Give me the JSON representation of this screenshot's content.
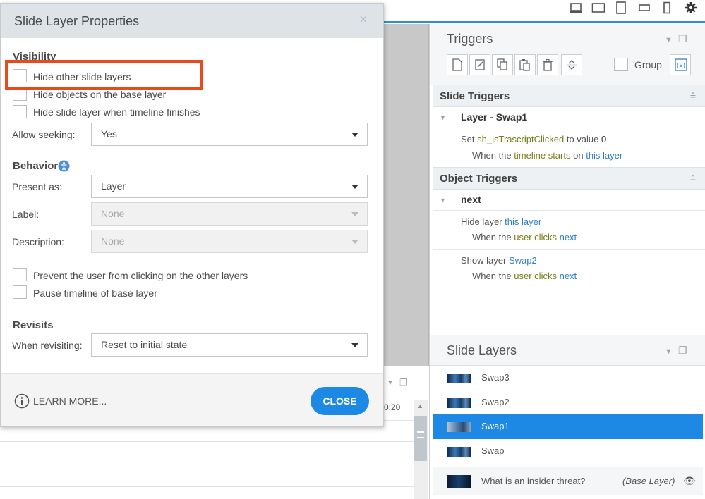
{
  "dialog": {
    "title": "Slide Layer Properties",
    "close_x": "×",
    "visibility": {
      "heading": "Visibility",
      "hide_other": "Hide other slide layers",
      "hide_base": "Hide objects on the base layer",
      "hide_when_finish": "Hide slide layer when timeline finishes",
      "allow_seeking_label": "Allow seeking:",
      "allow_seeking_value": "Yes"
    },
    "behavior": {
      "heading": "Behavior",
      "present_as_label": "Present as:",
      "present_as_value": "Layer",
      "label_label": "Label:",
      "label_value": "None",
      "description_label": "Description:",
      "description_value": "None",
      "prevent_click": "Prevent the user from clicking on the other layers",
      "pause_timeline": "Pause timeline of base layer"
    },
    "revisits": {
      "heading": "Revisits",
      "when_label": "When revisiting:",
      "when_value": "Reset to initial state"
    },
    "footer": {
      "learn_more": "LEARN MORE...",
      "close": "CLOSE"
    }
  },
  "timeline": {
    "time_label": "0:20"
  },
  "triggers_panel": {
    "title": "Triggers",
    "group_label": "Group",
    "slide_triggers": {
      "heading": "Slide Triggers",
      "group_name": "Layer - Swap1",
      "items": [
        {
          "action": "Set",
          "target": "sh_isTrascriptClicked",
          "mid": "to value",
          "value": "0",
          "when": "When the",
          "event": "timeline starts",
          "on": "on",
          "object": "this layer"
        }
      ]
    },
    "object_triggers": {
      "heading": "Object Triggers",
      "group_name": "next",
      "items": [
        {
          "action": "Hide layer",
          "target": "this layer",
          "when": "When the",
          "event": "user clicks",
          "object": "next"
        },
        {
          "action": "Show layer",
          "target": "Swap2",
          "when": "When the",
          "event": "user clicks",
          "object": "next"
        }
      ]
    }
  },
  "layers_panel": {
    "title": "Slide Layers",
    "layers": [
      {
        "name": "Swap3",
        "selected": false
      },
      {
        "name": "Swap2",
        "selected": false
      },
      {
        "name": "Swap1",
        "selected": true
      },
      {
        "name": "Swap",
        "selected": false
      }
    ],
    "base_layer": {
      "name": "What is an insider threat?",
      "tag": "(Base Layer)"
    }
  },
  "colors": {
    "accent": "#1e88e5",
    "highlight": "#e8491d",
    "keyword_event": "#7a7a18",
    "keyword_object": "#2f7fc0"
  }
}
